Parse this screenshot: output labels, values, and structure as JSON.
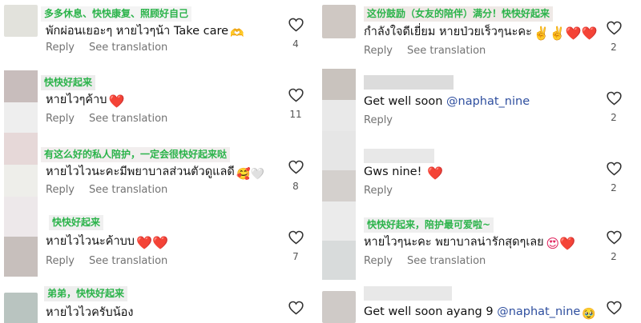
{
  "left": [
    {
      "translation": "多多休息、快快康复、照顾好自己",
      "text": "พักผ่อนเยอะๆ หายไวๆน้า Take care",
      "emoji": "🫶",
      "reply": "Reply",
      "see_translation": "See translation",
      "likes": "4"
    },
    {
      "translation": "快快好起来",
      "text": "หายไวๆค้าบ",
      "emoji": "❤️",
      "reply": "Reply",
      "see_translation": "See translation",
      "likes": "11"
    },
    {
      "translation": "有这么好的私人陪护，一定会很快好起来哒",
      "text": "หายไวไวนะคะมีพยาบาลส่วนตัวดูแลดี",
      "emoji": "🥰🤍",
      "reply": "Reply",
      "see_translation": "See translation",
      "likes": "8"
    },
    {
      "translation": "快快好起来",
      "text": "หายไวไวนะค้าบบ",
      "emoji": "❤️❤️",
      "reply": "Reply",
      "see_translation": "See translation",
      "likes": "7"
    },
    {
      "translation": "弟弟，快快好起来",
      "text": "หายไวไวครับน้อง",
      "emoji": "",
      "reply": "",
      "see_translation": "",
      "likes": ""
    }
  ],
  "right": [
    {
      "translation": "这份鼓励（女友的陪伴）满分！快快好起来",
      "text": "กำลังใจดีเยี่ยม หายป่วยเร็วๆนะคะ",
      "emoji": "✌️✌️❤️❤️",
      "mention": "",
      "reply": "Reply",
      "see_translation": "See translation",
      "likes": "2"
    },
    {
      "translation": "",
      "text": "Get well soon ",
      "emoji": "",
      "mention": "@naphat_nine",
      "reply": "Reply",
      "see_translation": "",
      "likes": "2"
    },
    {
      "translation": "",
      "text": "Gws nine! ",
      "emoji": "❤️",
      "mention": "",
      "reply": "Reply",
      "see_translation": "",
      "likes": "2"
    },
    {
      "translation": "快快好起来，陪护最可爱啦~",
      "text": "หายไวๆนะคะ พยาบาลน่ารักสุดๆเลย",
      "emoji": "😍❤️",
      "mention": "",
      "reply": "Reply",
      "see_translation": "See translation",
      "likes": "2"
    },
    {
      "translation": "",
      "text": "Get well soon ayang 9 ",
      "emoji": "🥹",
      "mention": "@naphat_nine",
      "reply": "",
      "see_translation": "",
      "likes": ""
    }
  ]
}
